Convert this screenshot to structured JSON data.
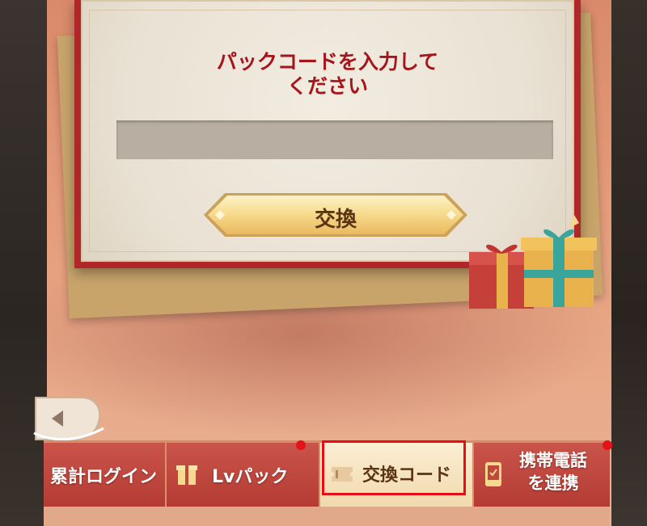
{
  "dialog": {
    "title_line1": "パックコードを入力して",
    "title_line2": "ください",
    "code_input": {
      "value": "",
      "placeholder": ""
    },
    "exchange_label": "交換"
  },
  "tabs": [
    {
      "label": "累計ログイン",
      "badge": false
    },
    {
      "label": "Lvパック",
      "badge": true
    },
    {
      "label": "交換コード",
      "badge": false,
      "active": true
    },
    {
      "label_line1": "携帯電話",
      "label_line2": "を連携",
      "badge": true
    }
  ],
  "icons": {
    "back": "back-arrow-icon",
    "gift": "gift-box-icon",
    "ticket": "ticket-icon",
    "phone": "phone-icon"
  },
  "colors": {
    "dialog_frame": "#b0272a",
    "title": "#a4161b",
    "highlight": "#e80d12",
    "badge": "#e3131a"
  }
}
